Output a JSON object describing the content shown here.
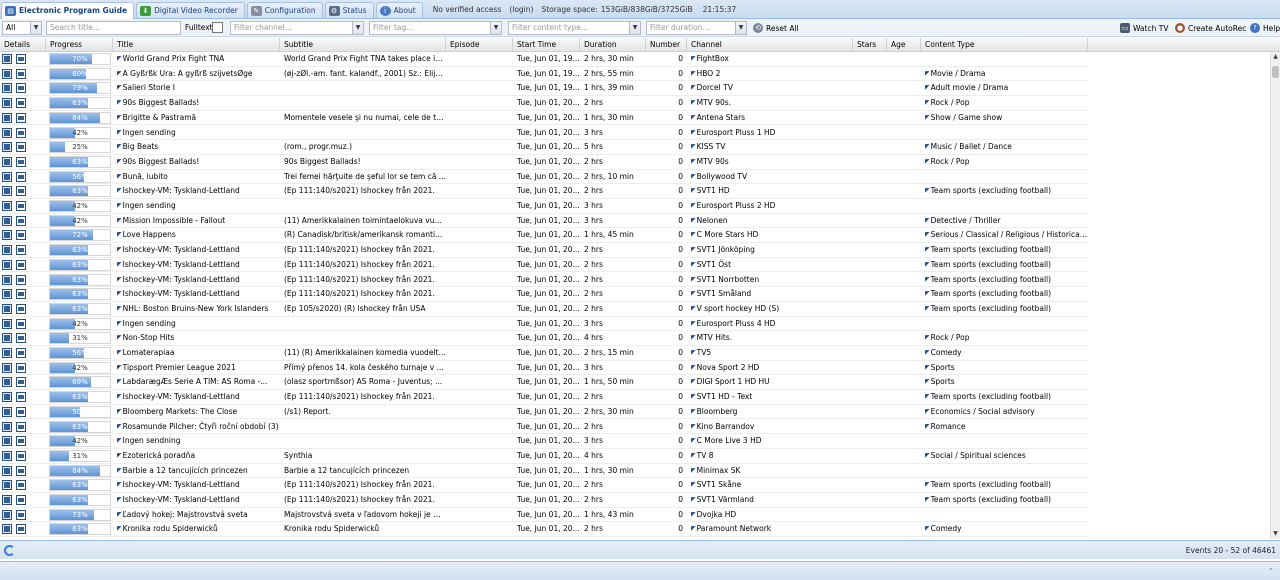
{
  "tabs": [
    {
      "label": "Electronic Program Guide",
      "icon": "epg-icon",
      "active": true
    },
    {
      "label": "Digital Video Recorder",
      "icon": "dvr-download-icon"
    },
    {
      "label": "Configuration",
      "icon": "wrench-icon"
    },
    {
      "label": "Status",
      "icon": "status-icon"
    },
    {
      "label": "About",
      "icon": "info-icon"
    }
  ],
  "header_info": {
    "access": "No verified access",
    "login": "(login)",
    "storage_label": "Storage space:",
    "storage_value": "153GiB/838GiB/3725GiB",
    "clock": "21:15:37"
  },
  "filters": {
    "all_value": "All",
    "search_placeholder": "Search title...",
    "fulltext_label": "Fulltext",
    "channel_placeholder": "Filter channel...",
    "tag_placeholder": "Filter tag...",
    "content_type_placeholder": "Filter content type...",
    "duration_placeholder": "Filter duration...",
    "reset_label": "Reset All"
  },
  "toolbar": {
    "watch_tv": "Watch TV",
    "create_autorec": "Create AutoRec",
    "help": "Help"
  },
  "columns": [
    "Details",
    "Progress",
    "Title",
    "Subtitle",
    "Episode",
    "Start Time",
    "Duration",
    "Number",
    "Channel",
    "Stars",
    "Age",
    "Content Type"
  ],
  "rows": [
    {
      "progress": 70,
      "label": "70%",
      "title": "World Grand Prix Fight TNA",
      "subtitle": "World Grand Prix Fight TNA takes place in ...",
      "start": "Tue, Jun 01, 19...",
      "duration": "2 hrs, 30 min",
      "number": "0",
      "channel": "FightBox",
      "ctype": ""
    },
    {
      "progress": 60,
      "label": "60%",
      "title": "A Gyßrßk Ura: A gyßrß szijvetsØge",
      "subtitle": "(øj-zØl.-am. fant. kalandf., 2001) Sz.: Elijah ...",
      "start": "Tue, Jun 01, 19...",
      "duration": "2 hrs, 55 min",
      "number": "0",
      "channel": "HBO 2",
      "ctype": "Movie / Drama"
    },
    {
      "progress": 79,
      "label": "79%",
      "title": "Salieri Storie I",
      "subtitle": "",
      "start": "Tue, Jun 01, 19...",
      "duration": "1 hrs, 39 min",
      "number": "0",
      "channel": "Dorcel TV",
      "ctype": "Adult movie / Drama"
    },
    {
      "progress": 63,
      "label": "63%",
      "title": "90s Biggest Ballads!",
      "subtitle": "",
      "start": "Tue, Jun 01, 20...",
      "duration": "2 hrs",
      "number": "0",
      "channel": "MTV 90s.",
      "ctype": "Rock / Pop"
    },
    {
      "progress": 84,
      "label": "84%",
      "title": "Brigitte & Pastramă",
      "subtitle": "Momentele vesele şi nu numai, cele de ta...",
      "start": "Tue, Jun 01, 20...",
      "duration": "1 hrs, 30 min",
      "number": "0",
      "channel": "Antena Stars",
      "ctype": "Show / Game show"
    },
    {
      "progress": 42,
      "label": "42%",
      "title": "Ingen sending",
      "subtitle": "",
      "start": "Tue, Jun 01, 20...",
      "duration": "3 hrs",
      "number": "0",
      "channel": "Eurosport Pluss 1 HD",
      "ctype": ""
    },
    {
      "progress": 25,
      "label": "25%",
      "title": "Big Beats",
      "subtitle": "(rom., progr.muz.)",
      "start": "Tue, Jun 01, 20...",
      "duration": "5 hrs",
      "number": "0",
      "channel": "KISS TV",
      "ctype": "Music / Ballet / Dance"
    },
    {
      "progress": 63,
      "label": "63%",
      "title": "90s Biggest Ballads!",
      "subtitle": "90s Biggest Ballads!",
      "start": "Tue, Jun 01, 20...",
      "duration": "2 hrs",
      "number": "0",
      "channel": "MTV 90s",
      "ctype": "Rock / Pop"
    },
    {
      "progress": 56,
      "label": "56%",
      "title": "Bună, iubito",
      "subtitle": "Trei femei hărţuite de şeful lor se tem că ...",
      "start": "Tue, Jun 01, 20...",
      "duration": "2 hrs, 10 min",
      "number": "0",
      "channel": "Bollywood TV",
      "ctype": ""
    },
    {
      "progress": 63,
      "label": "63%",
      "title": "Ishockey-VM: Tyskland-Lettland",
      "subtitle": "(Ep 111:140/s2021) Ishockey från 2021.",
      "start": "Tue, Jun 01, 20...",
      "duration": "2 hrs",
      "number": "0",
      "channel": "SVT1 HD",
      "ctype": "Team sports (excluding football)"
    },
    {
      "progress": 42,
      "label": "42%",
      "title": "Ingen sending",
      "subtitle": "",
      "start": "Tue, Jun 01, 20...",
      "duration": "3 hrs",
      "number": "0",
      "channel": "Eurosport Pluss 2 HD",
      "ctype": ""
    },
    {
      "progress": 42,
      "label": "42%",
      "title": "Mission Impossible - Fallout",
      "subtitle": "(11) Amerikkalainen toimintaelokuva vuo...",
      "start": "Tue, Jun 01, 20...",
      "duration": "3 hrs",
      "number": "0",
      "channel": "Nelonen",
      "ctype": "Detective / Thriller"
    },
    {
      "progress": 72,
      "label": "72%",
      "title": "Love Happens",
      "subtitle": "(R) Canadisk/britisk/amerikansk romanti...",
      "start": "Tue, Jun 01, 20...",
      "duration": "1 hrs, 45 min",
      "number": "0",
      "channel": "C More Stars HD",
      "ctype": "Serious / Classical / Religious / Historical ..."
    },
    {
      "progress": 63,
      "label": "63%",
      "title": "Ishockey-VM: Tyskland-Lettland",
      "subtitle": "(Ep 111:140/s2021) Ishockey från 2021.",
      "start": "Tue, Jun 01, 20...",
      "duration": "2 hrs",
      "number": "0",
      "channel": "SVT1 Jönköping",
      "ctype": "Team sports (excluding football)"
    },
    {
      "progress": 63,
      "label": "63%",
      "title": "Ishockey-VM: Tyskland-Lettland",
      "subtitle": "(Ep 111:140/s2021) Ishockey från 2021.",
      "start": "Tue, Jun 01, 20...",
      "duration": "2 hrs",
      "number": "0",
      "channel": "SVT1 Öst",
      "ctype": "Team sports (excluding football)"
    },
    {
      "progress": 63,
      "label": "63%",
      "title": "Ishockey-VM: Tyskland-Lettland",
      "subtitle": "(Ep 111:140/s2021) Ishockey från 2021.",
      "start": "Tue, Jun 01, 20...",
      "duration": "2 hrs",
      "number": "0",
      "channel": "SVT1 Norrbotten",
      "ctype": "Team sports (excluding football)"
    },
    {
      "progress": 63,
      "label": "63%",
      "title": "Ishockey-VM: Tyskland-Lettland",
      "subtitle": "(Ep 111:140/s2021) Ishockey från 2021.",
      "start": "Tue, Jun 01, 20...",
      "duration": "2 hrs",
      "number": "0",
      "channel": "SVT1 Småland",
      "ctype": "Team sports (excluding football)"
    },
    {
      "progress": 63,
      "label": "63%",
      "title": "NHL: Boston Bruins-New York Islanders",
      "subtitle": "(Ep 105/s2020) (R) Ishockey från USA",
      "start": "Tue, Jun 01, 20...",
      "duration": "2 hrs",
      "number": "0",
      "channel": "V sport hockey HD (S)",
      "ctype": "Team sports (excluding football)"
    },
    {
      "progress": 42,
      "label": "42%",
      "title": "Ingen sending",
      "subtitle": "",
      "start": "Tue, Jun 01, 20...",
      "duration": "3 hrs",
      "number": "0",
      "channel": "Eurosport Pluss 4 HD",
      "ctype": ""
    },
    {
      "progress": 31,
      "label": "31%",
      "title": "Non-Stop Hits",
      "subtitle": "",
      "start": "Tue, Jun 01, 20...",
      "duration": "4 hrs",
      "number": "0",
      "channel": "MTV Hits.",
      "ctype": "Rock / Pop"
    },
    {
      "progress": 56,
      "label": "56%",
      "title": "Lomaterapiaa",
      "subtitle": "(11) (R) Amerikkalainen komedia vuodelta...",
      "start": "Tue, Jun 01, 20...",
      "duration": "2 hrs, 15 min",
      "number": "0",
      "channel": "TV5",
      "ctype": "Comedy"
    },
    {
      "progress": 42,
      "label": "42%",
      "title": "Tipsport Premier League 2021",
      "subtitle": "Přímý přenos 14. kola českého turnaje v ...",
      "start": "Tue, Jun 01, 20...",
      "duration": "3 hrs",
      "number": "0",
      "channel": "Nova Sport 2 HD",
      "ctype": "Sports"
    },
    {
      "progress": 69,
      "label": "69%",
      "title": "LabdarægÆs Serie A TIM: AS Roma -...",
      "subtitle": "(olasz sportmßsor) AS Roma - Juventus; ...",
      "start": "Tue, Jun 01, 20...",
      "duration": "1 hrs, 50 min",
      "number": "0",
      "channel": "DIGI Sport 1 HD HU",
      "ctype": "Sports"
    },
    {
      "progress": 63,
      "label": "63%",
      "title": "Ishockey-VM: Tyskland-Lettland",
      "subtitle": "(Ep 111:140/s2021) Ishockey från 2021.",
      "start": "Tue, Jun 01, 20...",
      "duration": "2 hrs",
      "number": "0",
      "channel": "SVT1 HD - Text",
      "ctype": "Team sports (excluding football)"
    },
    {
      "progress": 50,
      "label": "50%",
      "title": "Bloomberg Markets: The Close",
      "subtitle": "(/s1) Report.",
      "start": "Tue, Jun 01, 20...",
      "duration": "2 hrs, 30 min",
      "number": "0",
      "channel": "Bloomberg",
      "ctype": "Economics / Social advisory"
    },
    {
      "progress": 63,
      "label": "63%",
      "title": "Rosamunde Pilcher: Čtyři roční období (3)",
      "subtitle": "",
      "start": "Tue, Jun 01, 20...",
      "duration": "2 hrs",
      "number": "0",
      "channel": "Kino Barrandov",
      "ctype": "Romance"
    },
    {
      "progress": 42,
      "label": "42%",
      "title": "Ingen sendning",
      "subtitle": "",
      "start": "Tue, Jun 01, 20...",
      "duration": "3 hrs",
      "number": "0",
      "channel": "C More Live 3 HD",
      "ctype": ""
    },
    {
      "progress": 31,
      "label": "31%",
      "title": "Ezoterická poradňa",
      "subtitle": "Synthia",
      "start": "Tue, Jun 01, 20...",
      "duration": "4 hrs",
      "number": "0",
      "channel": "TV 8",
      "ctype": "Social / Spiritual sciences"
    },
    {
      "progress": 84,
      "label": "84%",
      "title": "Barbie a 12 tancujících princezen",
      "subtitle": "Barbie a 12 tancujících princezen",
      "start": "Tue, Jun 01, 20...",
      "duration": "1 hrs, 30 min",
      "number": "0",
      "channel": "Minimax SK",
      "ctype": ""
    },
    {
      "progress": 63,
      "label": "63%",
      "title": "Ishockey-VM: Tyskland-Lettland",
      "subtitle": "(Ep 111:140/s2021) Ishockey från 2021.",
      "start": "Tue, Jun 01, 20...",
      "duration": "2 hrs",
      "number": "0",
      "channel": "SVT1 Skåne",
      "ctype": "Team sports (excluding football)"
    },
    {
      "progress": 63,
      "label": "63%",
      "title": "Ishockey-VM: Tyskland-Lettland",
      "subtitle": "(Ep 111:140/s2021) Ishockey från 2021.",
      "start": "Tue, Jun 01, 20...",
      "duration": "2 hrs",
      "number": "0",
      "channel": "SVT1 Värmland",
      "ctype": "Team sports (excluding football)"
    },
    {
      "progress": 73,
      "label": "73%",
      "title": "Ľadový hokej: Majstrovstvá sveta",
      "subtitle": "Majstrovstvá sveta v ľadovom hokeji je m...",
      "start": "Tue, Jun 01, 20...",
      "duration": "1 hrs, 43 min",
      "number": "0",
      "channel": "Dvojka HD",
      "ctype": ""
    },
    {
      "progress": 63,
      "label": "63%",
      "title": "Kronika rodu Spiderwicků",
      "subtitle": "Kronika rodu Spiderwicků",
      "start": "Tue, Jun 01, 20...",
      "duration": "2 hrs",
      "number": "0",
      "channel": "Paramount Network",
      "ctype": "Comedy"
    }
  ],
  "footer": {
    "events": "Events 20 - 52 of 46461"
  }
}
